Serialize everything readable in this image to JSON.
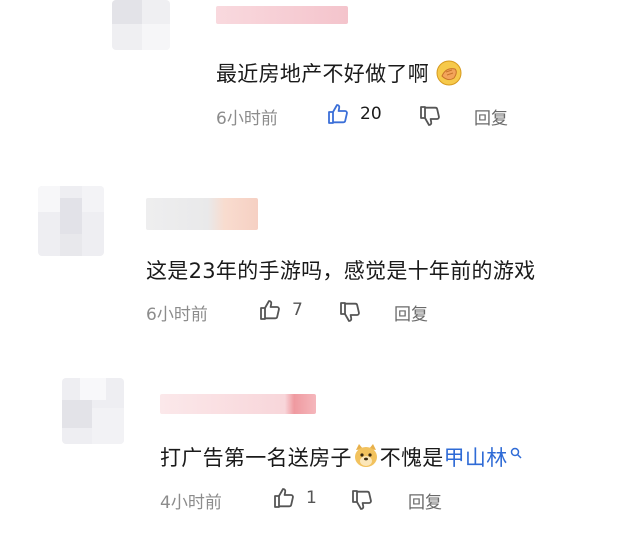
{
  "comments": [
    {
      "text": "最近房地产不好做了啊",
      "time": "6小时前",
      "likes": "20",
      "reply_label": "回复",
      "like_color": "#3b6fd8"
    },
    {
      "text": "这是23年的手游吗，感觉是十年前的游戏",
      "time": "6小时前",
      "likes": "7",
      "reply_label": "回复"
    },
    {
      "text_before": "打广告第一名送房子",
      "text_middle": "不愧是",
      "mention": "甲山林",
      "time": "4小时前",
      "likes": "1",
      "reply_label": "回复"
    }
  ],
  "icons": {
    "facepalm": "facepalm-emoji-icon",
    "dog": "dog-face-emoji-icon",
    "search": "search-icon",
    "thumbs_up": "thumbs-up-icon",
    "thumbs_down": "thumbs-down-icon"
  },
  "colors": {
    "mention": "#2f6bd6",
    "meta": "#8c8c8c",
    "like_active": "#3b6fd8"
  }
}
